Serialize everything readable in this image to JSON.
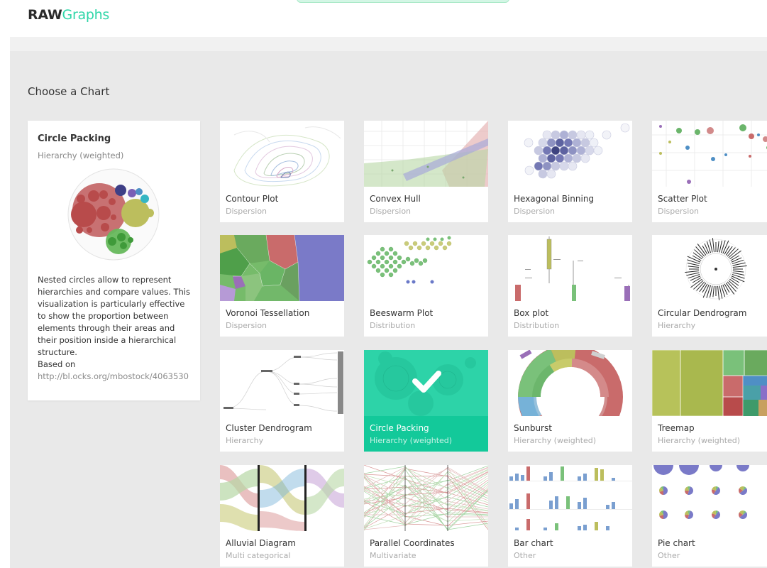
{
  "brand": {
    "bold": "RAW",
    "light": "Graphs"
  },
  "section_title": "Choose a Chart",
  "selected_chart": {
    "title": "Circle Packing",
    "category": "Hierarchy (weighted)",
    "description": "Nested circles allow to represent hierarchies and compare values. This visualization is particularly effective to show the proportion between elements through their areas and their position inside a hierarchical structure.",
    "based_on_label": "Based on",
    "based_on_link": "http://bl.ocks.org/mbostock/4063530"
  },
  "charts": [
    {
      "name": "Contour Plot",
      "category": "Dispersion",
      "icon": "contour-plot-thumbnail",
      "selected": false
    },
    {
      "name": "Convex Hull",
      "category": "Dispersion",
      "icon": "convex-hull-thumbnail",
      "selected": false
    },
    {
      "name": "Hexagonal Binning",
      "category": "Dispersion",
      "icon": "hexagonal-binning-thumbnail",
      "selected": false
    },
    {
      "name": "Scatter Plot",
      "category": "Dispersion",
      "icon": "scatter-plot-thumbnail",
      "selected": false
    },
    {
      "name": "Voronoi Tessellation",
      "category": "Dispersion",
      "icon": "voronoi-thumbnail",
      "selected": false
    },
    {
      "name": "Beeswarm Plot",
      "category": "Distribution",
      "icon": "beeswarm-thumbnail",
      "selected": false
    },
    {
      "name": "Box plot",
      "category": "Distribution",
      "icon": "box-plot-thumbnail",
      "selected": false
    },
    {
      "name": "Circular Dendrogram",
      "category": "Hierarchy",
      "icon": "circular-dendrogram-thumbnail",
      "selected": false
    },
    {
      "name": "Cluster Dendrogram",
      "category": "Hierarchy",
      "icon": "cluster-dendrogram-thumbnail",
      "selected": false
    },
    {
      "name": "Circle Packing",
      "category": "Hierarchy (weighted)",
      "icon": "circle-packing-thumbnail",
      "selected": true
    },
    {
      "name": "Sunburst",
      "category": "Hierarchy (weighted)",
      "icon": "sunburst-thumbnail",
      "selected": false
    },
    {
      "name": "Treemap",
      "category": "Hierarchy (weighted)",
      "icon": "treemap-thumbnail",
      "selected": false
    },
    {
      "name": "Alluvial Diagram",
      "category": "Multi categorical",
      "icon": "alluvial-thumbnail",
      "selected": false
    },
    {
      "name": "Parallel Coordinates",
      "category": "Multivariate",
      "icon": "parallel-coordinates-thumbnail",
      "selected": false
    },
    {
      "name": "Bar chart",
      "category": "Other",
      "icon": "bar-chart-thumbnail",
      "selected": false
    },
    {
      "name": "Pie chart",
      "category": "Other",
      "icon": "pie-chart-thumbnail",
      "selected": false
    }
  ],
  "colors": {
    "accent": "#13c99a",
    "brand_light": "#2fd6a8",
    "background": "#e9e9e9"
  }
}
